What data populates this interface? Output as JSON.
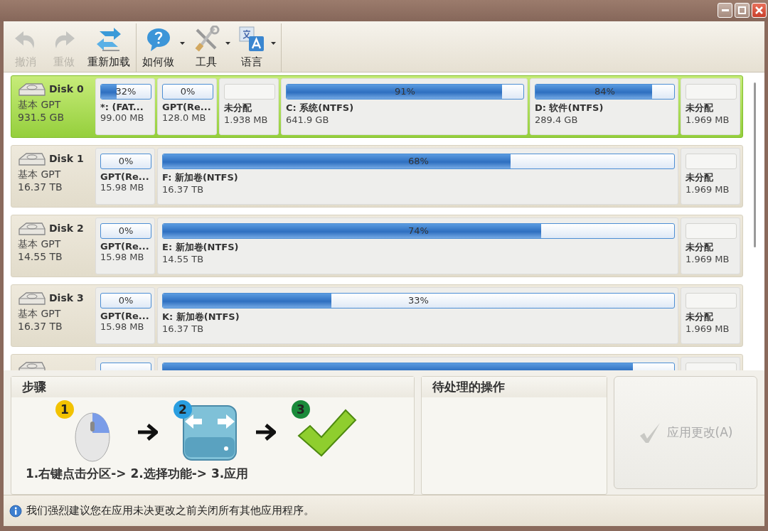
{
  "toolbar": [
    {
      "kind": "undo",
      "label": "撤消",
      "disabled": true,
      "dropdown": false
    },
    {
      "kind": "redo",
      "label": "重做",
      "disabled": true,
      "dropdown": false
    },
    {
      "kind": "reload",
      "label": "重新加载",
      "disabled": false,
      "dropdown": false
    },
    {
      "kind": "help",
      "label": "如何做",
      "disabled": false,
      "dropdown": true
    },
    {
      "kind": "tools",
      "label": "工具",
      "disabled": false,
      "dropdown": true
    },
    {
      "kind": "language",
      "label": "语言",
      "disabled": false,
      "dropdown": true
    }
  ],
  "disks": [
    {
      "name": "Disk 0",
      "type": "基本 GPT",
      "size": "931.5 GB",
      "selected": true,
      "partitions": [
        {
          "kind": "small",
          "percent": "32%",
          "level": 0.32,
          "label": "*: (FAT...",
          "size": "99.00 MB"
        },
        {
          "kind": "small",
          "percent": "0%",
          "label": "GPT(Re...",
          "size": "128.0 MB"
        },
        {
          "kind": "small",
          "label": "未分配",
          "size": "1.938 MB"
        },
        {
          "kind": "large",
          "percent": "91%",
          "level": 0.91,
          "label": "C: 系统(NTFS)",
          "size": "641.9 GB"
        },
        {
          "kind": "medium",
          "percent": "84%",
          "level": 0.84,
          "label": "D: 软件(NTFS)",
          "size": "289.4 GB"
        },
        {
          "kind": "small",
          "label": "未分配",
          "size": "1.969 MB"
        }
      ]
    },
    {
      "name": "Disk 1",
      "type": "基本 GPT",
      "size": "16.37 TB",
      "selected": false,
      "partitions": [
        {
          "kind": "small",
          "percent": "0%",
          "label": "GPT(Re...",
          "size": "15.98 MB"
        },
        {
          "kind": "large",
          "percent": "68%",
          "level": 0.68,
          "label": "F: 新加卷(NTFS)",
          "size": "16.37 TB"
        },
        {
          "kind": "small",
          "label": "未分配",
          "size": "1.969 MB"
        }
      ]
    },
    {
      "name": "Disk 2",
      "type": "基本 GPT",
      "size": "14.55 TB",
      "selected": false,
      "partitions": [
        {
          "kind": "small",
          "percent": "0%",
          "label": "GPT(Re...",
          "size": "15.98 MB"
        },
        {
          "kind": "large",
          "percent": "74%",
          "level": 0.74,
          "label": "E: 新加卷(NTFS)",
          "size": "14.55 TB"
        },
        {
          "kind": "small",
          "label": "未分配",
          "size": "1.969 MB"
        }
      ]
    },
    {
      "name": "Disk 3",
      "type": "基本 GPT",
      "size": "16.37 TB",
      "selected": false,
      "partitions": [
        {
          "kind": "small",
          "percent": "0%",
          "label": "GPT(Re...",
          "size": "15.98 MB"
        },
        {
          "kind": "large",
          "percent": "33%",
          "level": 0.33,
          "label": "K: 新加卷(NTFS)",
          "size": "16.37 TB"
        },
        {
          "kind": "small",
          "label": "未分配",
          "size": "1.969 MB"
        }
      ]
    },
    {
      "selected": false,
      "partitions": [
        {
          "kind": "small",
          "allocated": true
        },
        {
          "kind": "large",
          "level": 0.92
        },
        {
          "kind": "small"
        }
      ]
    }
  ],
  "steps": {
    "title": "步骤",
    "badges": [
      {
        "text": "1",
        "color": "#f2c200"
      },
      {
        "text": "2",
        "color": "#2a9ee0"
      },
      {
        "text": "3",
        "color": "#1a8a3a"
      }
    ],
    "caption": "1.右键点击分区-> 2.选择功能-> 3.应用"
  },
  "pending": {
    "title": "待处理的操作"
  },
  "apply_button": {
    "label": "应用更改(A)",
    "disabled": true
  },
  "status_bar": {
    "text": "我们强烈建议您在应用未决更改之前关闭所有其他应用程序。"
  }
}
